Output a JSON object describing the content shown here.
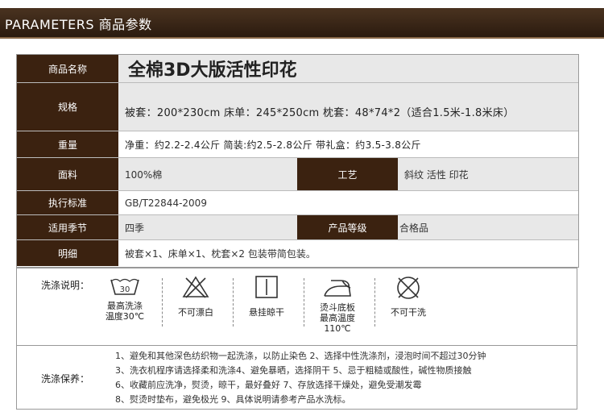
{
  "header": {
    "title": "PARAMETERS 商品参数"
  },
  "params": {
    "name_label": "商品名称",
    "name_value": "全棉3D大版活性印花",
    "spec_label": "规格",
    "spec_value": "被套：200*230cm 床单：245*250cm 枕套：48*74*2（适合1.5米-1.8米床）",
    "weight_label": "重量",
    "weight_value": "净重：约2.2-2.4公斤   简装:约2.5-2.8公斤   带礼盒：约3.5-3.8公斤",
    "fabric_label": "面料",
    "fabric_value": "100%棉",
    "craft_label": "工艺",
    "craft_value": "斜纹 活性 印花",
    "standard_label": "执行标准",
    "standard_value": "GB/T22844-2009",
    "season_label": "适用季节",
    "season_value": "四季",
    "grade_label": "产品等级",
    "grade_value": "合格品",
    "detail_label": "明细",
    "detail_value": "被套×1、床单×1、枕套×2  包装带简包装。"
  },
  "wash": {
    "label": "洗涤说明：",
    "icons": [
      {
        "icon": "wash-30-icon",
        "caption1": "最高洗涤",
        "caption2": "温度30℃",
        "number": "30"
      },
      {
        "icon": "no-bleach-icon",
        "caption1": "不可漂白",
        "caption2": ""
      },
      {
        "icon": "hang-dry-icon",
        "caption1": "悬挂晾干",
        "caption2": ""
      },
      {
        "icon": "iron-110-icon",
        "caption1": "烫斗底板",
        "caption2": "最高温度110℃"
      },
      {
        "icon": "no-dry-clean-icon",
        "caption1": "不可干洗",
        "caption2": ""
      }
    ]
  },
  "care": {
    "label": "洗涤保养：",
    "tips": [
      "1、避免和其他深色纺织物一起洗涤，以防止染色 2、选择中性洗涤剂，浸泡时间不超过30分钟",
      "3、洗衣机程序请选择柔和洗涤4、避免暴晒，选择阴干 5、忌于粗糙或酸性，碱性物质接触",
      "6、收藏前应洗净，熨烫，晾干，最好叠好 7、存放选择干燥处，避免受潮发霉",
      "8、熨烫时垫布，避免极光 9、具体说明请参考产品水洗标。"
    ]
  }
}
